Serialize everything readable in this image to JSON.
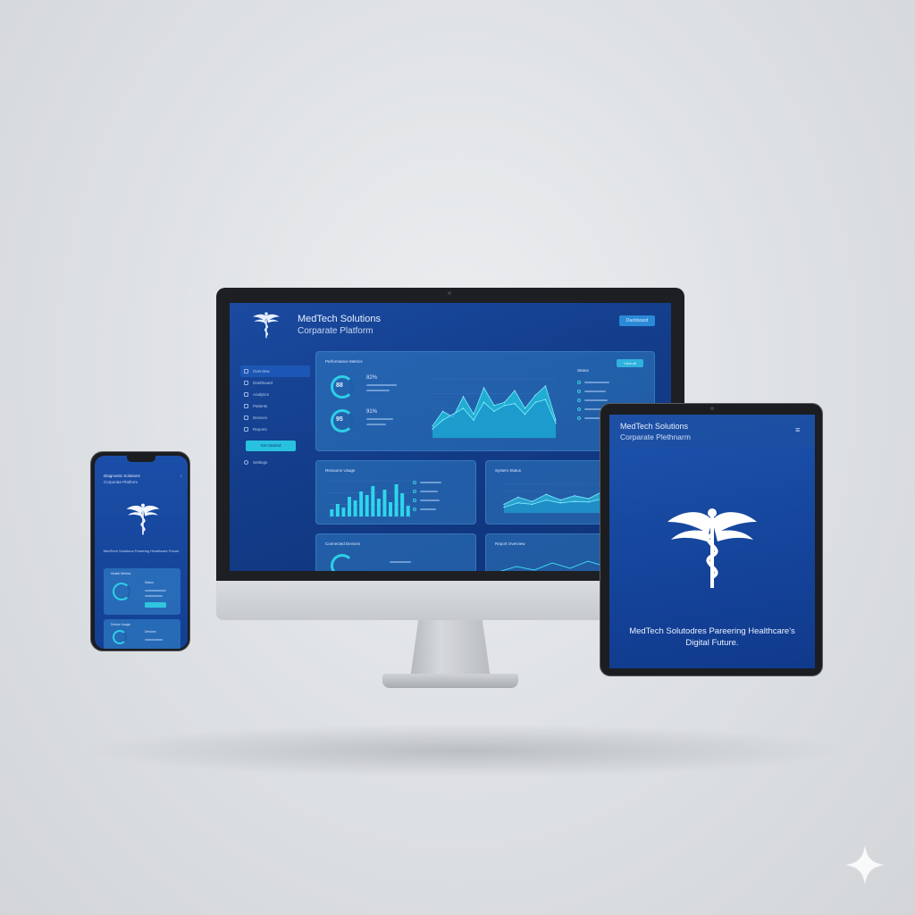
{
  "monitor": {
    "title": "MedTech Solutions",
    "subtitle": "Corparate Platform",
    "header_button": "Dashboard",
    "sidebar": {
      "items": [
        {
          "label": "Overview"
        },
        {
          "label": "Dashboard"
        },
        {
          "label": "Analytics"
        },
        {
          "label": "Patients"
        },
        {
          "label": "Devices"
        },
        {
          "label": "Reports"
        }
      ],
      "cta": "Get Started",
      "footer": "Settings"
    },
    "cards": {
      "performance": {
        "title": "Performance Metrics",
        "button": "View all",
        "stat_top": "82%",
        "stat_bottom": "91%",
        "ring_top": "88",
        "ring_bottom": "95",
        "legend_title": "Status"
      },
      "resource": {
        "title": "Resource Usage"
      },
      "system": {
        "title": "System Status"
      },
      "connected": {
        "title": "Connected Devices"
      },
      "report": {
        "title": "Report Overview"
      }
    }
  },
  "phone": {
    "title": "Diagnostic Solutions",
    "subtitle": "Corporate Platform",
    "tagline": "MedTech Solutions Powering Healthcare Future",
    "card1_title": "Health Metrics",
    "card1_label": "Status",
    "card2_title": "Device Usage",
    "card2_label": "Devices"
  },
  "tablet": {
    "title": "MedTech Solutions",
    "subtitle": "Corparate Plethnarm",
    "tagline": "MedTech Solutodres Pareering Healthcare's Digital Future."
  },
  "chart_data": [
    {
      "type": "area",
      "x": [
        1,
        2,
        3,
        4,
        5,
        6,
        7,
        8,
        9,
        10,
        11,
        12,
        13
      ],
      "series": [
        {
          "values": [
            20,
            45,
            35,
            70,
            40,
            85,
            55,
            60,
            80,
            50,
            72,
            88,
            30
          ]
        },
        {
          "values": [
            15,
            30,
            40,
            50,
            30,
            60,
            45,
            55,
            58,
            40,
            60,
            65,
            25
          ]
        }
      ],
      "ylim": [
        0,
        100
      ]
    },
    {
      "type": "bar",
      "values": [
        20,
        35,
        25,
        55,
        45,
        70,
        60,
        85,
        50,
        75,
        40,
        90,
        65,
        30
      ],
      "ylim": [
        0,
        100
      ]
    },
    {
      "type": "area",
      "x": [
        1,
        2,
        3,
        4,
        5,
        6,
        7,
        8,
        9,
        10,
        11
      ],
      "series": [
        {
          "values": [
            30,
            55,
            40,
            65,
            45,
            60,
            50,
            75,
            55,
            70,
            45
          ]
        },
        {
          "values": [
            20,
            35,
            30,
            45,
            35,
            40,
            38,
            50,
            42,
            48,
            35
          ]
        }
      ],
      "ylim": [
        0,
        100
      ]
    }
  ]
}
